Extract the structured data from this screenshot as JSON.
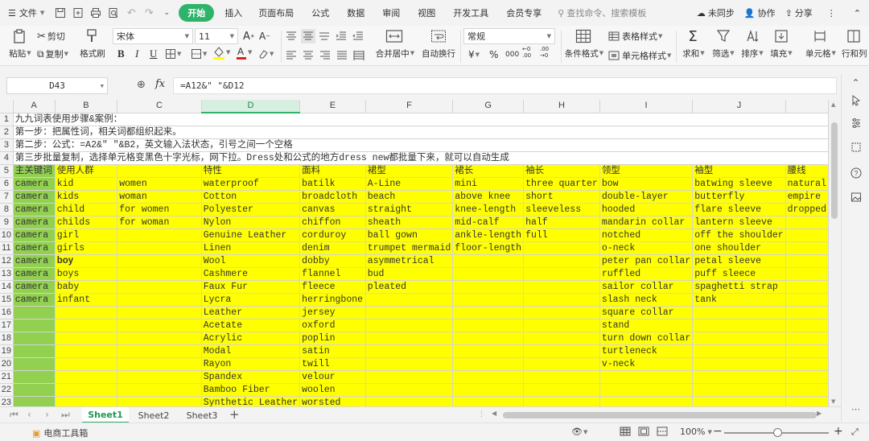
{
  "menu": {
    "file": "文件",
    "tabs": [
      "开始",
      "插入",
      "页面布局",
      "公式",
      "数据",
      "审阅",
      "视图",
      "开发工具",
      "会员专享"
    ],
    "search_placeholder": "查找命令、搜索模板",
    "sync": "未同步",
    "collab": "协作",
    "share": "分享"
  },
  "ribbon": {
    "paste": "粘贴",
    "cut": "剪切",
    "copy": "复制",
    "format_painter": "格式刷",
    "font_name": "宋体",
    "font_size": "11",
    "merge_center": "合并居中",
    "wrap_text": "自动换行",
    "number_format": "常规",
    "conditional_format": "条件格式",
    "table_style": "表格样式",
    "cell_style": "单元格样式",
    "sum": "求和",
    "filter": "筛选",
    "sort": "排序",
    "fill": "填充",
    "cell": "单元格",
    "row_col": "行和列"
  },
  "formula_bar": {
    "name_box": "D43",
    "fx": "fx",
    "formula": "=A12&\" \"&D12"
  },
  "grid": {
    "columns": [
      "A",
      "B",
      "C",
      "D",
      "E",
      "F",
      "G",
      "H",
      "I",
      "J",
      ""
    ],
    "selected_column": "D",
    "notes": {
      "r1": "九九词表使用步骤&案例：",
      "r2": "第一步：把属性词，相关词都组织起来。",
      "r3": "第二步：公式：=A2&\" \"&B2，英文输入法状态，引号之间一个空格",
      "r4": "第三步批量复制，选择单元格变黑色十字光标，网下拉。Dress处和公式的地方dress new都批量下来，就可以自动生成"
    },
    "headers": [
      "主关键词",
      "使用人群",
      "",
      "特性",
      "面料",
      "裙型",
      "裙长",
      "袖长",
      "领型",
      "袖型",
      "腰线"
    ],
    "rows": [
      [
        "camera",
        "kid",
        "women",
        "waterproof",
        "batilk",
        "A-Line",
        "mini",
        "three quarter",
        "bow",
        "batwing sleeve",
        "natural"
      ],
      [
        "camera",
        "kids",
        "woman",
        "Cotton",
        "broadcloth",
        "beach",
        "above knee",
        "short",
        "double-layer",
        "butterfly",
        "empire"
      ],
      [
        "camera",
        "child",
        "for women",
        "Polyester",
        "canvas",
        "straight",
        "knee-length",
        "sleeveless",
        "hooded",
        "flare sleeve",
        "dropped"
      ],
      [
        "camera",
        "childs",
        "for woman",
        "Nylon",
        "chiffon",
        "sheath",
        "mid-calf",
        "half",
        "mandarin collar",
        "lantern sleeve",
        ""
      ],
      [
        "camera",
        "girl",
        "",
        "Genuine Leather",
        "corduroy",
        "ball gown",
        "ankle-length",
        "full",
        "notched",
        "off the shoulder",
        ""
      ],
      [
        "camera",
        "girls",
        "",
        "Linen",
        "denim",
        "trumpet mermaid",
        "floor-length",
        "",
        "o-neck",
        "one shoulder",
        ""
      ],
      [
        "camera",
        "boy",
        "",
        "Wool",
        "dobby",
        "asymmetrical",
        "",
        "",
        "peter pan collar",
        "petal sleeve",
        ""
      ],
      [
        "camera",
        "boys",
        "",
        "Cashmere",
        "flannel",
        "bud",
        "",
        "",
        "ruffled",
        "puff sleece",
        ""
      ],
      [
        "camera",
        "baby",
        "",
        "Faux Fur",
        "fleece",
        "pleated",
        "",
        "",
        "sailor collar",
        "spaghetti strap",
        ""
      ],
      [
        "camera",
        "infant",
        "",
        "Lycra",
        "herringbone",
        "",
        "",
        "",
        "slash neck",
        "tank",
        ""
      ],
      [
        "",
        "",
        "",
        "Leather",
        "jersey",
        "",
        "",
        "",
        "square collar",
        "",
        ""
      ],
      [
        "",
        "",
        "",
        "Acetate",
        "oxford",
        "",
        "",
        "",
        "stand",
        "",
        ""
      ],
      [
        "",
        "",
        "",
        "Acrylic",
        "poplin",
        "",
        "",
        "",
        "turn down collar",
        "",
        ""
      ],
      [
        "",
        "",
        "",
        "Modal",
        "satin",
        "",
        "",
        "",
        "turtleneck",
        "",
        ""
      ],
      [
        "",
        "",
        "",
        "Rayon",
        "twill",
        "",
        "",
        "",
        "v-neck",
        "",
        ""
      ],
      [
        "",
        "",
        "",
        "Spandex",
        "velour",
        "",
        "",
        "",
        "",
        "",
        ""
      ],
      [
        "",
        "",
        "",
        "Bamboo Fiber",
        "woolen",
        "",
        "",
        "",
        "",
        "",
        ""
      ],
      [
        "",
        "",
        "",
        "Synthetic Leather",
        "worsted",
        "",
        "",
        "",
        "",
        "",
        ""
      ]
    ]
  },
  "sheets": [
    "Sheet1",
    "Sheet2",
    "Sheet3"
  ],
  "active_sheet": "Sheet1",
  "status": {
    "toolbox": "电商工具箱",
    "zoom": "100%"
  },
  "colors": {
    "accent": "#2fb36a",
    "yellow_fill": "#ffff00",
    "green_fill": "#92d050"
  }
}
